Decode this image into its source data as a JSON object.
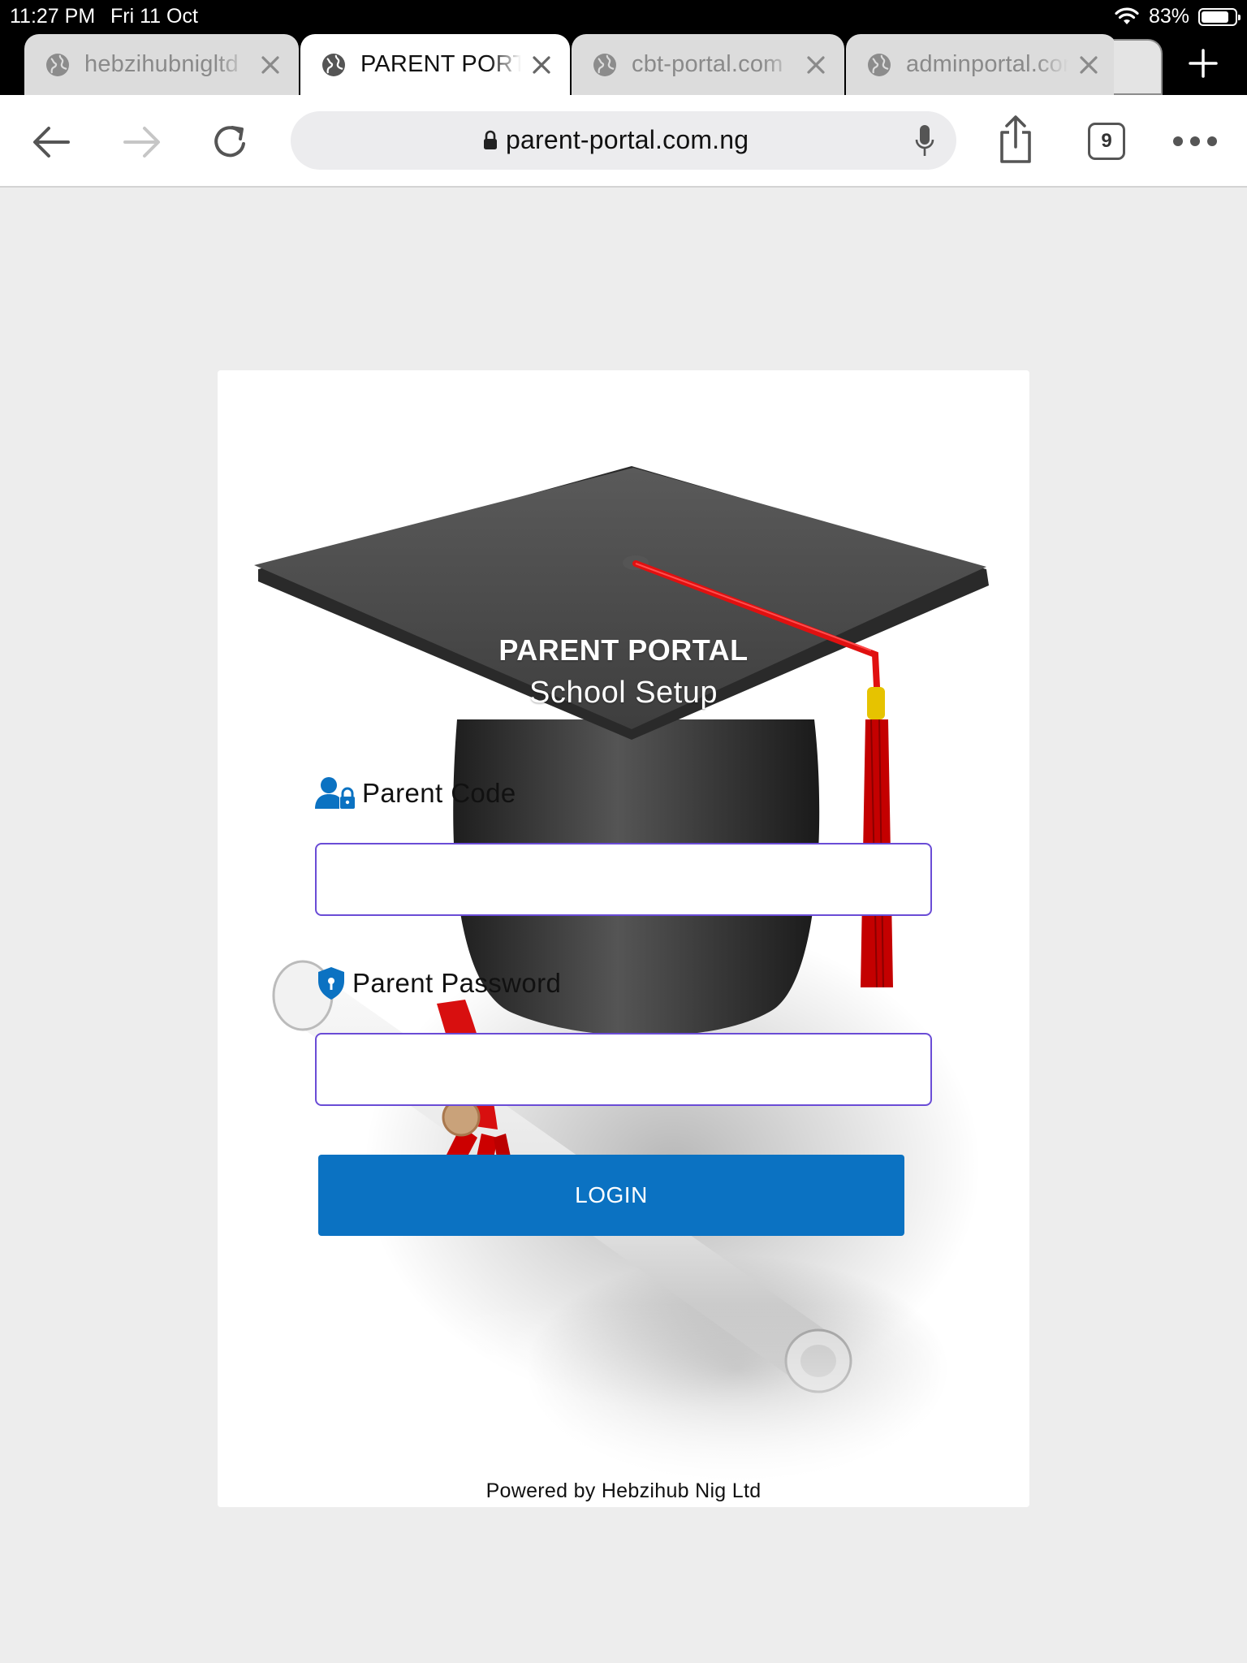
{
  "status_bar": {
    "time": "11:27 PM",
    "date": "Fri 11 Oct",
    "battery_percent": "83%",
    "battery_level": 0.83
  },
  "tabs": [
    {
      "title": "hebzihubnigltd",
      "active": false
    },
    {
      "title": "PARENT PORTAL",
      "active": true
    },
    {
      "title": "cbt-portal.com",
      "active": false
    },
    {
      "title": "adminportal.com",
      "active": false
    }
  ],
  "toolbar": {
    "url": "parent-portal.com.ng",
    "tab_count": "9"
  },
  "login": {
    "title": "PARENT PORTAL",
    "subtitle": "School Setup",
    "code_label": "Parent Code",
    "code_value": "",
    "password_label": "Parent Password",
    "password_value": "",
    "button_label": "LOGIN",
    "footer": "Powered by Hebzihub Nig Ltd"
  },
  "colors": {
    "accent_button": "#0b72c2",
    "input_border": "#6a4cd6",
    "icon_blue": "#0b72c2",
    "page_bg": "#ededed"
  },
  "icons": {
    "globe": "globe-icon",
    "close": "close-icon",
    "back": "back-arrow-icon",
    "forward": "forward-arrow-icon",
    "reload": "reload-icon",
    "lock": "lock-icon",
    "mic": "microphone-icon",
    "share": "share-icon",
    "more": "more-icon",
    "new_tab": "plus-icon",
    "parent_code": "user-lock-icon",
    "parent_password": "shield-keyhole-icon"
  }
}
